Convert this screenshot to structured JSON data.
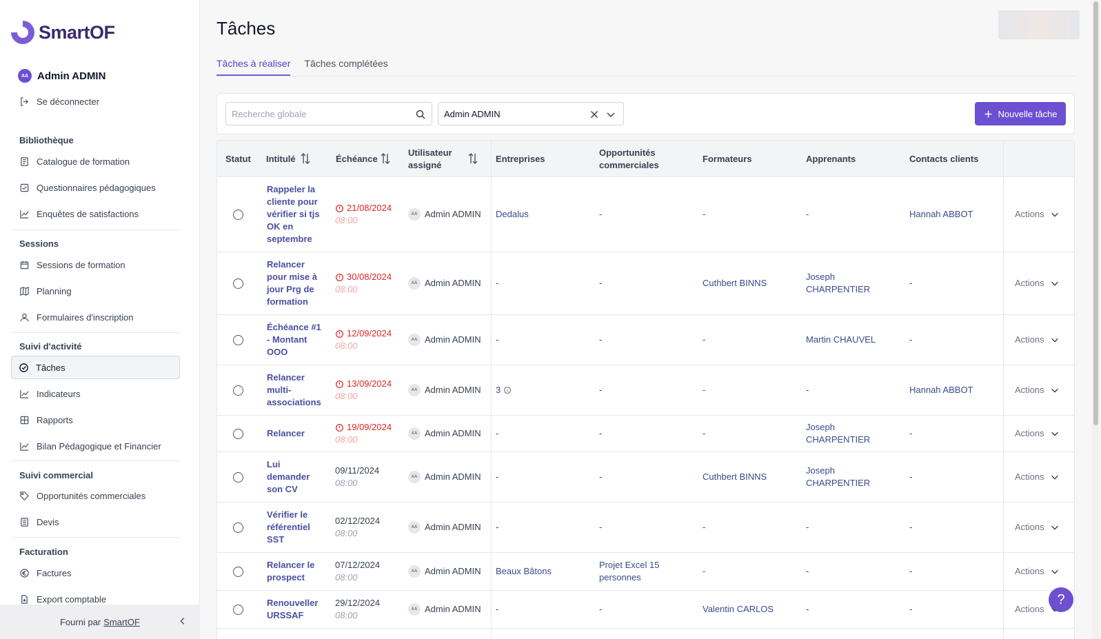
{
  "brand": {
    "name": "SmartOF"
  },
  "user": {
    "initials": "AA",
    "name": "Admin ADMIN",
    "logout": "Se déconnecter"
  },
  "sidebar": {
    "sections": [
      {
        "title": "Bibliothèque",
        "items": [
          "Catalogue de formation",
          "Questionnaires pédagogiques",
          "Enquêtes de satisfactions"
        ]
      },
      {
        "title": "Sessions",
        "items": [
          "Sessions de formation",
          "Planning",
          "Formulaires d'inscription"
        ]
      },
      {
        "title": "Suivi d'activité",
        "items": [
          "Tâches",
          "Indicateurs",
          "Rapports",
          "Bilan Pédagogique et Financier"
        ]
      },
      {
        "title": "Suivi commercial",
        "items": [
          "Opportunités commerciales",
          "Devis"
        ]
      },
      {
        "title": "Facturation",
        "items": [
          "Factures",
          "Export comptable"
        ]
      }
    ],
    "footer": {
      "prefix": "Fourni par",
      "link": "SmartOF"
    }
  },
  "page": {
    "title": "Tâches",
    "tabs": [
      "Tâches à réaliser",
      "Tâches complétées"
    ],
    "search_placeholder": "Recherche globale",
    "user_filter": "Admin ADMIN",
    "new_button": "Nouvelle tâche"
  },
  "table": {
    "headers": [
      "Statut",
      "Intitulé",
      "Échéance",
      "Utilisateur assigné",
      "Entreprises",
      "Opportunités commerciales",
      "Formateurs",
      "Apprenants",
      "Contacts clients"
    ],
    "actions_label": "Actions",
    "rows": [
      {
        "title": "Rappeler la cliente pour vérifier si tjs OK en septembre",
        "date": "21/08/2024",
        "time": "08:00",
        "overdue": true,
        "assignee": "Admin ADMIN",
        "company": "Dedalus",
        "opportunity": "-",
        "trainer": "-",
        "learner": "-",
        "contact": "Hannah ABBOT"
      },
      {
        "title": "Relancer pour mise à jour Prg de formation",
        "date": "30/08/2024",
        "time": "08:00",
        "overdue": true,
        "assignee": "Admin ADMIN",
        "company": "-",
        "opportunity": "-",
        "trainer": "Cuthbert BINNS",
        "learner": "Joseph CHARPENTIER",
        "contact": "-"
      },
      {
        "title": "Échéance #1 - Montant OOO",
        "date": "12/09/2024",
        "time": "08:00",
        "overdue": true,
        "assignee": "Admin ADMIN",
        "company": "-",
        "opportunity": "-",
        "trainer": "-",
        "learner": "Martin CHAUVEL",
        "contact": "-"
      },
      {
        "title": "Relancer multi-associations",
        "date": "13/09/2024",
        "time": "08:00",
        "overdue": true,
        "assignee": "Admin ADMIN",
        "company": "3",
        "opportunity": "-",
        "trainer": "-",
        "learner": "-",
        "contact": "Hannah ABBOT"
      },
      {
        "title": "Relancer",
        "date": "19/09/2024",
        "time": "08:00",
        "overdue": true,
        "assignee": "Admin ADMIN",
        "company": "-",
        "opportunity": "-",
        "trainer": "-",
        "learner": "Joseph CHARPENTIER",
        "contact": "-"
      },
      {
        "title": "Lui demander son CV",
        "date": "09/11/2024",
        "time": "08:00",
        "overdue": false,
        "assignee": "Admin ADMIN",
        "company": "-",
        "opportunity": "-",
        "trainer": "Cuthbert BINNS",
        "learner": "Joseph CHARPENTIER",
        "contact": "-"
      },
      {
        "title": "Vérifier le référentiel SST",
        "date": "02/12/2024",
        "time": "08:00",
        "overdue": false,
        "assignee": "Admin ADMIN",
        "company": "-",
        "opportunity": "-",
        "trainer": "-",
        "learner": "-",
        "contact": "-"
      },
      {
        "title": "Relancer le prospect",
        "date": "07/12/2024",
        "time": "08:00",
        "overdue": false,
        "assignee": "Admin ADMIN",
        "company": "Beaux Bâtons",
        "opportunity": "Projet Excel 15 personnes",
        "trainer": "-",
        "learner": "-",
        "contact": "-"
      },
      {
        "title": "Renouveller URSSAF",
        "date": "29/12/2024",
        "time": "08:00",
        "overdue": false,
        "assignee": "Admin ADMIN",
        "company": "-",
        "opportunity": "-",
        "trainer": "Valentin CARLOS",
        "learner": "-",
        "contact": "-"
      }
    ]
  },
  "help": {
    "label": "?"
  },
  "colors": {
    "accent": "#6d4fd1",
    "overdue": "#dc2626",
    "link": "#3b4a8c"
  }
}
